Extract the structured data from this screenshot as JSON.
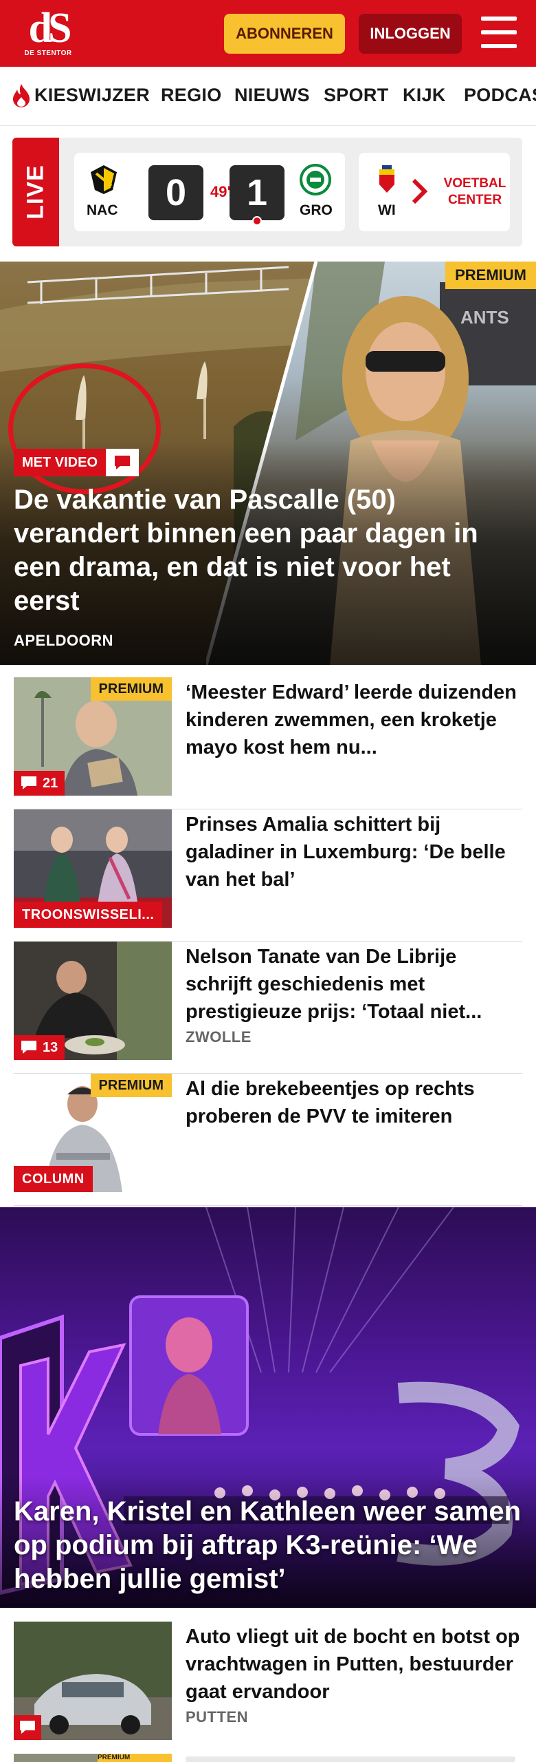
{
  "header": {
    "logo_mark": "dS",
    "logo_sub": "DE STENTOR",
    "subscribe_label": "ABONNEREN",
    "login_label": "INLOGGEN",
    "menu_icon": "hamburger-icon",
    "brand_color": "#d70f1b"
  },
  "nav": {
    "items": [
      {
        "label": "KIESWIJZER",
        "icon": "flame-icon"
      },
      {
        "label": "REGIO"
      },
      {
        "label": "NIEUWS"
      },
      {
        "label": "SPORT"
      },
      {
        "label": "KIJK"
      },
      {
        "label": "PODCAS"
      }
    ]
  },
  "live": {
    "label": "LIVE",
    "match": {
      "home_team": "NAC",
      "home_score": "0",
      "minute": "49'",
      "away_score": "1",
      "away_team": "GRO"
    },
    "next_match_team": "WI",
    "more_label": "VOETBAL CENTER"
  },
  "hero": {
    "badge": "PREMIUM",
    "video_label": "MET VIDEO",
    "title": "De vakantie van Pascalle (50) verandert binnen een paar dagen in een drama, en dat is niet voor het eerst",
    "location": "APELDOORN"
  },
  "articles": [
    {
      "title": "‘Meester Edward’ leerde duizenden kinderen zwemmen, een kroketje mayo kost hem nu...",
      "badge": "PREMIUM",
      "comments": "21"
    },
    {
      "title": "Prinses Amalia schittert bij galadiner in Luxemburg: ‘De belle van het bal’",
      "tag": "TROONSWISSELI..."
    },
    {
      "title": "Nelson Tanate van De Librije schrijft geschiedenis met prestigieuze prijs: ‘Totaal niet...",
      "location": "ZWOLLE",
      "comments": "13"
    },
    {
      "title": "Al die brekebeentjes op rechts proberen de PVV te imiteren",
      "badge": "PREMIUM",
      "tag": "COLUMN"
    }
  ],
  "feature": {
    "title": "Karen, Kristel en Kathleen weer samen op podium bij aftrap K3-reünie: ‘We hebben jullie gemist’"
  },
  "article5": {
    "title": "Auto vliegt uit de bocht en botst op vrachtwagen in Putten, bestuurder gaat ervandoor",
    "location": "PUTTEN"
  },
  "article6": {
    "badge": "PREMIUM"
  }
}
